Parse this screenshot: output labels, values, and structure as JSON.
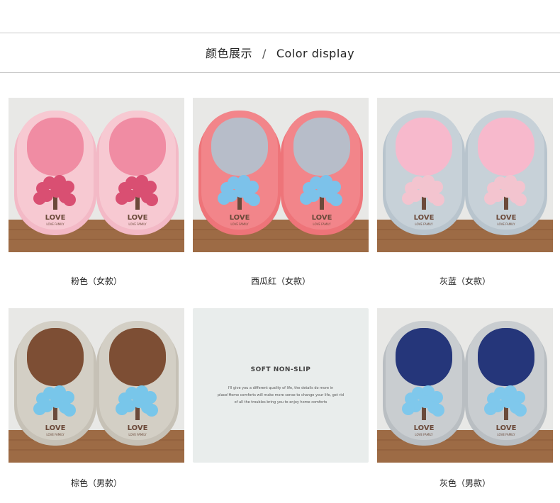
{
  "header": {
    "title_cn": "颜色展示",
    "separator": "/",
    "title_en": "Color display"
  },
  "products": [
    {
      "caption": "粉色（女款）",
      "colors": {
        "bg": "#e8e8e6",
        "floor": "#9d6b45",
        "body": "#f7c9d2",
        "sole": "#f3b9c6",
        "lining": "#f08ca3",
        "tree": "#d94f72",
        "trunk": "#6b4a3a"
      }
    },
    {
      "caption": "西瓜红（女款）",
      "colors": {
        "bg": "#e8e8e6",
        "floor": "#9d6b45",
        "body": "#f2858a",
        "sole": "#ee7479",
        "lining": "#b7bdc9",
        "tree": "#7cc2ea",
        "trunk": "#6b4a3a"
      }
    },
    {
      "caption": "灰蓝（女款）",
      "colors": {
        "bg": "#e8e8e6",
        "floor": "#9d6b45",
        "body": "#c7d1d8",
        "sole": "#b8c4cd",
        "lining": "#f7b9cc",
        "tree": "#f3c4cf",
        "trunk": "#6b4a3a"
      }
    },
    {
      "caption": "棕色（男款）",
      "colors": {
        "bg": "#e8e8e6",
        "floor": "#9d6b45",
        "body": "#d3cfc5",
        "sole": "#c6c1b6",
        "lining": "#7d4e34",
        "tree": "#78c6ea",
        "trunk": "#6b4a3a"
      }
    },
    {
      "caption": "灰色（男款）",
      "colors": {
        "bg": "#e8e8e6",
        "floor": "#9d6b45",
        "body": "#c9cdd0",
        "sole": "#b9bec2",
        "lining": "#25367a",
        "tree": "#7fc8ec",
        "trunk": "#6b4a3a"
      }
    }
  ],
  "print": {
    "love": "LOVE",
    "family": "LOVE FAMILY"
  },
  "info_card": {
    "title": "SOFT NON-SLIP",
    "text": "I'll give you a different quality of life, the details do more in place!Home comforts will make more sense to change your life, get rid of all the troubles bring you to enjoy home comforts"
  }
}
